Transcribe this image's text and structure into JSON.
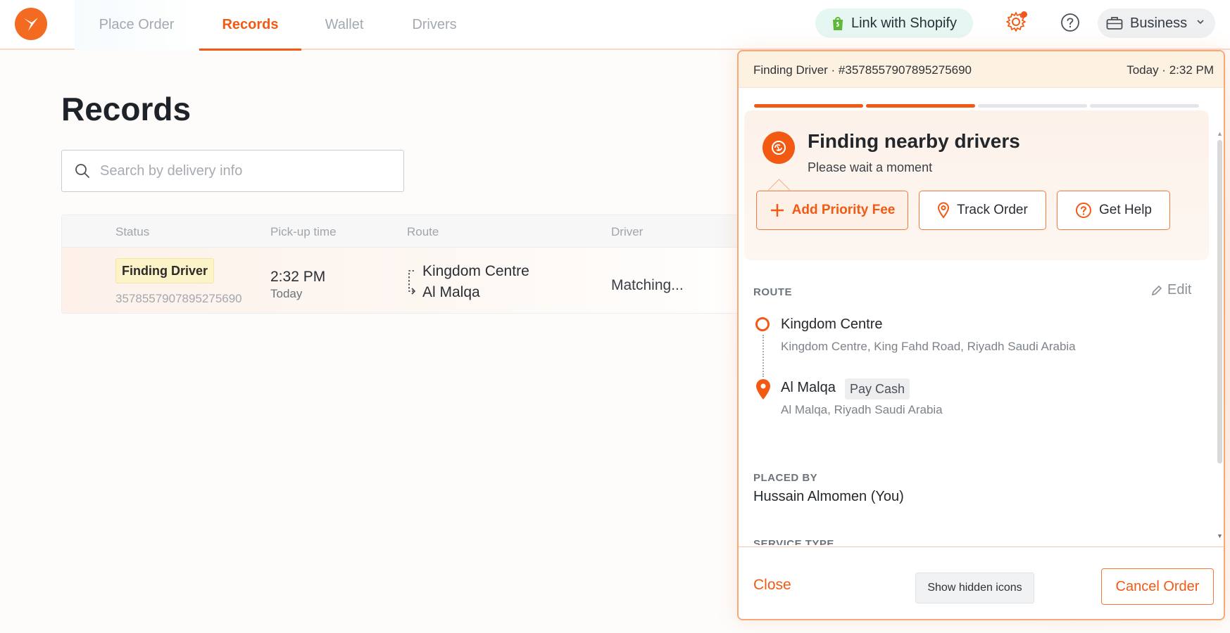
{
  "colors": {
    "accent": "#f25a13",
    "accent_light": "#fdf0e7",
    "badge_bg": "#fdf3c8",
    "shopify_bg": "#e6f6f3",
    "progress_done": "#f25a13",
    "progress_todo": "#e3e5e8"
  },
  "header": {
    "logo_icon": "bird-logo-icon",
    "tabs": [
      {
        "label": "Place Order",
        "active": false
      },
      {
        "label": "Records",
        "active": true
      },
      {
        "label": "Wallet",
        "active": false
      },
      {
        "label": "Drivers",
        "active": false
      }
    ],
    "shopify_label": "Link with Shopify",
    "shopify_icon": "shopify-bag-icon",
    "settings_icon": "gear-icon",
    "help_icon": "question-circle-icon",
    "account_label": "Business",
    "account_icon": "briefcase-icon"
  },
  "main": {
    "title": "Records",
    "search_placeholder": "Search by delivery info",
    "table": {
      "columns": [
        "Status",
        "Pick-up time",
        "Route",
        "Driver"
      ],
      "rows": [
        {
          "status": "Finding Driver",
          "order_id": "3578557907895275690",
          "pickup_time": "2:32 PM",
          "pickup_day": "Today",
          "route_from": "Kingdom Centre",
          "route_to": "Al Malqa",
          "driver": "Matching..."
        }
      ]
    }
  },
  "panel": {
    "header_left": "Finding Driver · #3578557907895275690",
    "header_right": "Today · 2:32 PM",
    "progress": {
      "total_steps": 4,
      "completed_steps": 2
    },
    "status_title": "Finding nearby drivers",
    "status_subtitle": "Please wait a moment",
    "actions": {
      "priority": "Add Priority Fee",
      "track": "Track Order",
      "help": "Get Help"
    },
    "route_label": "ROUTE",
    "edit_label": "Edit",
    "stops": [
      {
        "name": "Kingdom Centre",
        "address": "Kingdom Centre, King Fahd Road, Riyadh Saudi Arabia"
      },
      {
        "name": "Al Malqa",
        "address": "Al Malqa, Riyadh Saudi Arabia",
        "tag": "Pay Cash"
      }
    ],
    "placed_by_label": "PLACED BY",
    "placed_by": "Hussain Almomen (You)",
    "service_type_label": "SERVICE TYPE",
    "footer": {
      "close": "Close",
      "hidden_icons": "Show hidden icons",
      "cancel": "Cancel Order"
    }
  }
}
